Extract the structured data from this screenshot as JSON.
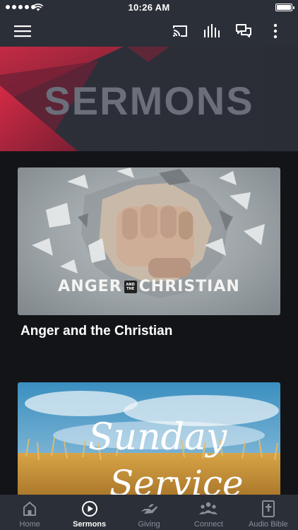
{
  "status_bar": {
    "time": "10:26 AM"
  },
  "app_bar": {
    "icons": [
      "menu-icon",
      "cast-icon",
      "audio-bars-icon",
      "chat-icon",
      "more-vertical-icon"
    ]
  },
  "hero": {
    "title": "SERMONS",
    "accent_color": "#c8263f"
  },
  "sermons": [
    {
      "title": "Anger and the Christian",
      "artwork_text_left": "ANGER",
      "artwork_text_small": "AND THE",
      "artwork_text_right": "CHRISTIAN"
    },
    {
      "artwork_text_line1": "Sunday",
      "artwork_text_line2": "Service"
    }
  ],
  "tab_bar": {
    "tabs": [
      {
        "label": "Home",
        "icon": "home-icon",
        "active": false
      },
      {
        "label": "Sermons",
        "icon": "play-circle-icon",
        "active": true
      },
      {
        "label": "Giving",
        "icon": "giving-hand-icon",
        "active": false
      },
      {
        "label": "Connect",
        "icon": "people-icon",
        "active": false
      },
      {
        "label": "Audio Bible",
        "icon": "bible-icon",
        "active": false
      }
    ]
  }
}
